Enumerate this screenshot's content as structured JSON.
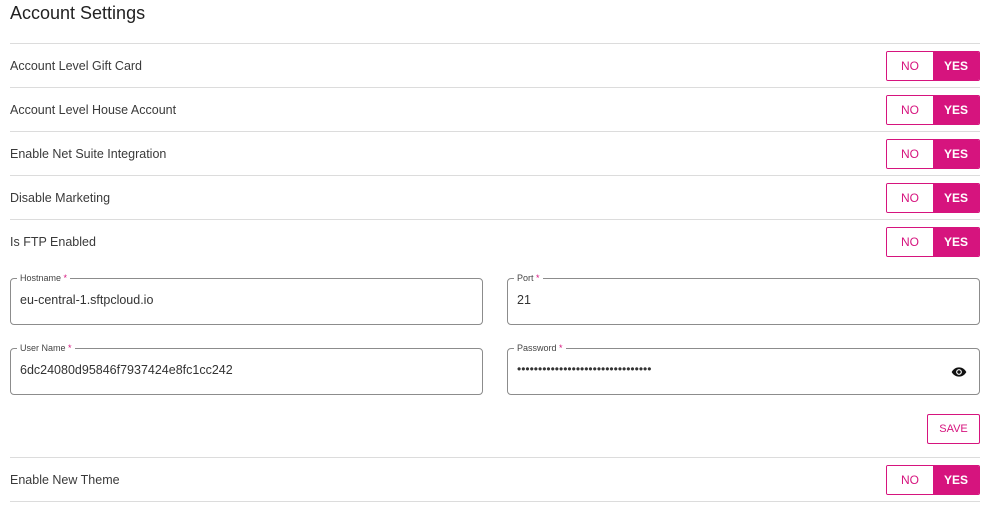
{
  "title": "Account Settings",
  "toggles": [
    {
      "label": "Account Level Gift Card",
      "no": "NO",
      "yes": "YES",
      "selected": "YES"
    },
    {
      "label": "Account Level House Account",
      "no": "NO",
      "yes": "YES",
      "selected": "YES"
    },
    {
      "label": "Enable Net Suite Integration",
      "no": "NO",
      "yes": "YES",
      "selected": "YES"
    },
    {
      "label": "Disable Marketing",
      "no": "NO",
      "yes": "YES",
      "selected": "YES"
    },
    {
      "label": "Is FTP Enabled",
      "no": "NO",
      "yes": "YES",
      "selected": "YES"
    }
  ],
  "ftp": {
    "hostname": {
      "label": "Hostname",
      "required": "*",
      "value": "eu-central-1.sftpcloud.io"
    },
    "port": {
      "label": "Port",
      "required": "*",
      "value": "21"
    },
    "username": {
      "label": "User Name",
      "required": "*",
      "value": "6dc24080d95846f7937424e8fc1cc242"
    },
    "password": {
      "label": "Password",
      "required": "*",
      "value": "••••••••••••••••••••••••••••••••",
      "icon": "eye-icon"
    },
    "save_label": "SAVE"
  },
  "theme_toggle": {
    "label": "Enable New Theme",
    "no": "NO",
    "yes": "YES",
    "selected": "YES"
  },
  "colors": {
    "accent": "#d6147e"
  }
}
